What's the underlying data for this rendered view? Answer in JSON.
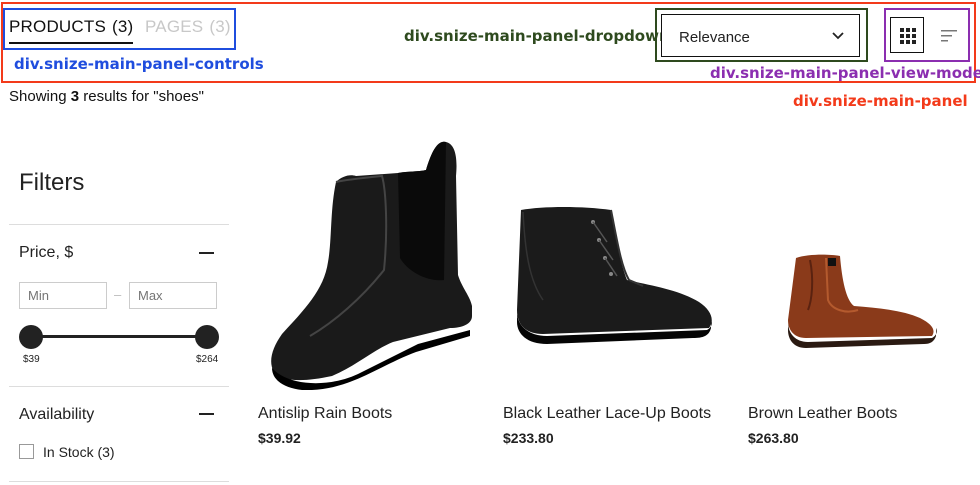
{
  "annotations": {
    "main_panel": "div.snize-main-panel",
    "controls": "div.snize-main-panel-controls",
    "dropdown": "div.snize-main-panel-dropdown",
    "view_mode": "div.snize-main-panel-view-mode"
  },
  "tabs": [
    {
      "label": "PRODUCTS",
      "count": "(3)",
      "active": true
    },
    {
      "label": "PAGES",
      "count": "(3)",
      "active": false
    }
  ],
  "sort": {
    "selected": "Relevance"
  },
  "view_mode": {
    "current": "grid",
    "icons": [
      "grid-icon",
      "list-icon"
    ]
  },
  "results": {
    "prefix": "Showing",
    "count": "3",
    "suffix": "results for \"shoes\""
  },
  "filters": {
    "title": "Filters",
    "price": {
      "title": "Price, $",
      "min_placeholder": "Min",
      "max_placeholder": "Max",
      "separator": "–",
      "range_min_label": "$39",
      "range_max_label": "$264"
    },
    "availability": {
      "title": "Availability",
      "options": [
        {
          "label": "In Stock (3)",
          "checked": false
        }
      ]
    }
  },
  "products": [
    {
      "name": "Antislip Rain Boots",
      "price": "$39.92",
      "image": "black-chelsea-boot"
    },
    {
      "name": "Black Leather Lace-Up Boots",
      "price": "$233.80",
      "image": "black-lace-up-boot"
    },
    {
      "name": "Brown Leather Boots",
      "price": "$263.80",
      "image": "brown-leather-boot"
    }
  ],
  "colors": {
    "main_panel_outline": "#f33a1a",
    "controls_outline": "#1f4dde",
    "dropdown_outline": "#2e4a1e",
    "view_mode_outline": "#8b2eb0"
  }
}
